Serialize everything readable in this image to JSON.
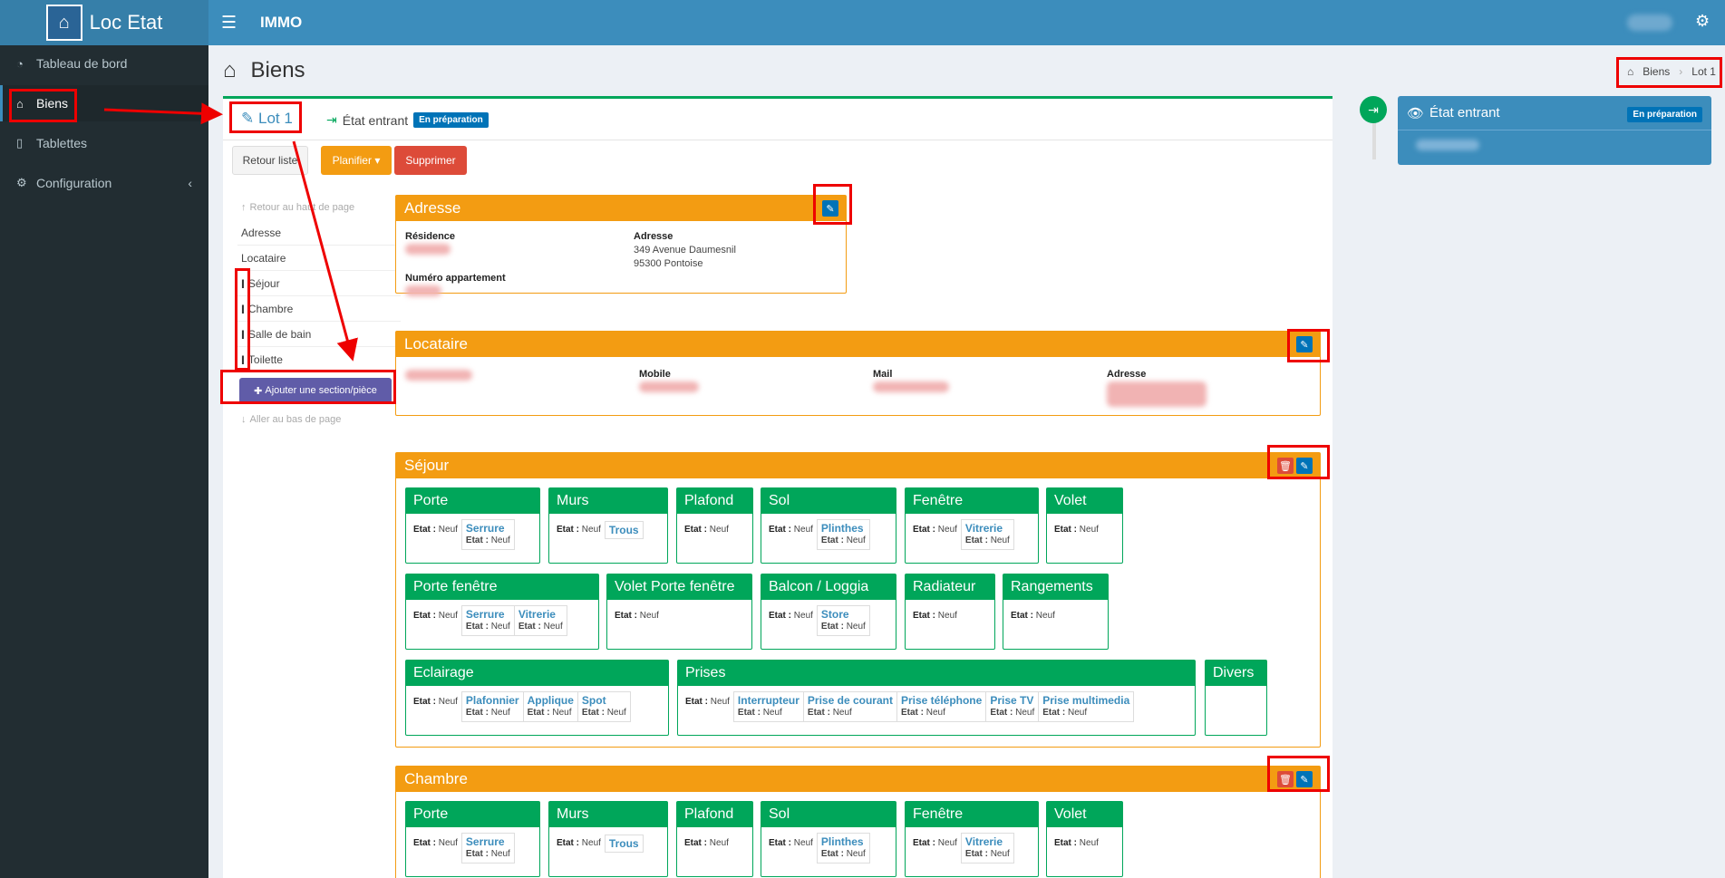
{
  "header": {
    "logo_text": "Loc Etat",
    "app_title": "IMMO",
    "menu_icon": "hamburger-icon",
    "settings_icon": "gears-icon"
  },
  "sidebar": {
    "items": [
      {
        "label": "Tableau de bord",
        "icon": "dashboard-icon"
      },
      {
        "label": "Biens",
        "icon": "home-icon"
      },
      {
        "label": "Tablettes",
        "icon": "tablet-icon"
      },
      {
        "label": "Configuration",
        "icon": "gears-icon"
      }
    ]
  },
  "page": {
    "title": "Biens"
  },
  "breadcrumb": {
    "items": [
      "Biens",
      "Lot 1"
    ]
  },
  "tabs": {
    "lot": "Lot 1",
    "etat": "État entrant",
    "badge": "En préparation"
  },
  "actions": {
    "retour": "Retour liste",
    "planifier": "Planifier",
    "supprimer": "Supprimer"
  },
  "toc": {
    "top": "Retour au haut de page",
    "items": [
      "Adresse",
      "Locataire",
      "Séjour",
      "Chambre",
      "Salle de bain",
      "Toilette"
    ],
    "add": "Ajouter une section/pièce",
    "bottom": "Aller au bas de page"
  },
  "adresse": {
    "title": "Adresse",
    "residence_label": "Résidence",
    "adresse_label": "Adresse",
    "adresse_line1": "349 Avenue Daumesnil",
    "adresse_line2": "95300 Pontoise",
    "numero_label": "Numéro appartement"
  },
  "locataire": {
    "title": "Locataire",
    "mobile_label": "Mobile",
    "mail_label": "Mail",
    "adresse_label": "Adresse"
  },
  "etat_label": "Etat :",
  "etat_value": "Neuf",
  "sejour": {
    "title": "Séjour",
    "cards": [
      "Porte",
      "Murs",
      "Plafond",
      "Sol",
      "Fenêtre",
      "Volet",
      "Porte fenêtre",
      "Volet Porte fenêtre",
      "Balcon / Loggia",
      "Radiateur",
      "Rangements",
      "Eclairage",
      "Prises",
      "Divers"
    ],
    "subs": {
      "porte": [
        "Serrure"
      ],
      "murs": [
        "Trous"
      ],
      "sol": [
        "Plinthes"
      ],
      "fenetre": [
        "Vitrerie"
      ],
      "porte_fenetre": [
        "Serrure",
        "Vitrerie"
      ],
      "balcon": [
        "Store"
      ],
      "eclairage": [
        "Plafonnier",
        "Applique",
        "Spot"
      ],
      "prises": [
        "Interrupteur",
        "Prise de courant",
        "Prise téléphone",
        "Prise TV",
        "Prise multimedia"
      ]
    }
  },
  "chambre": {
    "title": "Chambre",
    "cards": [
      "Porte",
      "Murs",
      "Plafond",
      "Sol",
      "Fenêtre",
      "Volet"
    ],
    "subs": {
      "porte": [
        "Serrure"
      ],
      "murs": [
        "Trous"
      ],
      "sol": [
        "Plinthes"
      ],
      "fenetre": [
        "Vitrerie"
      ]
    }
  },
  "timeline": {
    "title": "État entrant",
    "badge": "En préparation"
  },
  "colors": {
    "primary": "#3c8dbc",
    "sidebar": "#222d32",
    "orange": "#f39c12",
    "green": "#00a65a",
    "red": "#dd4b39",
    "purple": "#605ca8"
  }
}
